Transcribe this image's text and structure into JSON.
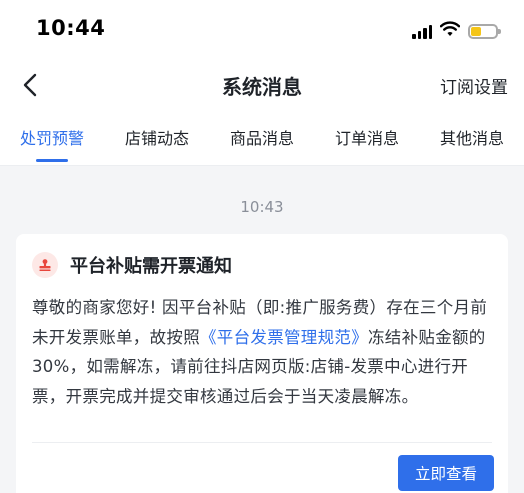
{
  "status_bar": {
    "time": "10:44",
    "battery_level_fraction": 0.4,
    "battery_color": "#f5c518"
  },
  "nav": {
    "back_icon": "chevron-left-icon",
    "title": "系统消息",
    "right_action": "订阅设置"
  },
  "tabs": [
    {
      "label": "处罚预警",
      "active": true
    },
    {
      "label": "店铺动态",
      "active": false
    },
    {
      "label": "商品消息",
      "active": false
    },
    {
      "label": "订单消息",
      "active": false
    },
    {
      "label": "其他消息",
      "active": false
    }
  ],
  "message": {
    "time": "10:43",
    "icon": "warning-stamp-icon",
    "title": "平台补贴需开票通知",
    "body_before_link": "尊敬的商家您好! 因平台补贴（即:推广服务费）存在三个月前未开发票账单，故按照",
    "body_link": "《平台发票管理规范》",
    "body_after_link": "冻结补贴金额的30%，如需解冻，请前往抖店网页版:店铺-发票中心进行开票，开票完成并提交审核通过后会于当天凌晨解冻。",
    "action_label": "立即查看"
  },
  "colors": {
    "accent": "#2f6fea",
    "warning_icon": "#e8453c",
    "warning_icon_bg": "#fde8e6",
    "page_bg": "#f4f5f7"
  }
}
